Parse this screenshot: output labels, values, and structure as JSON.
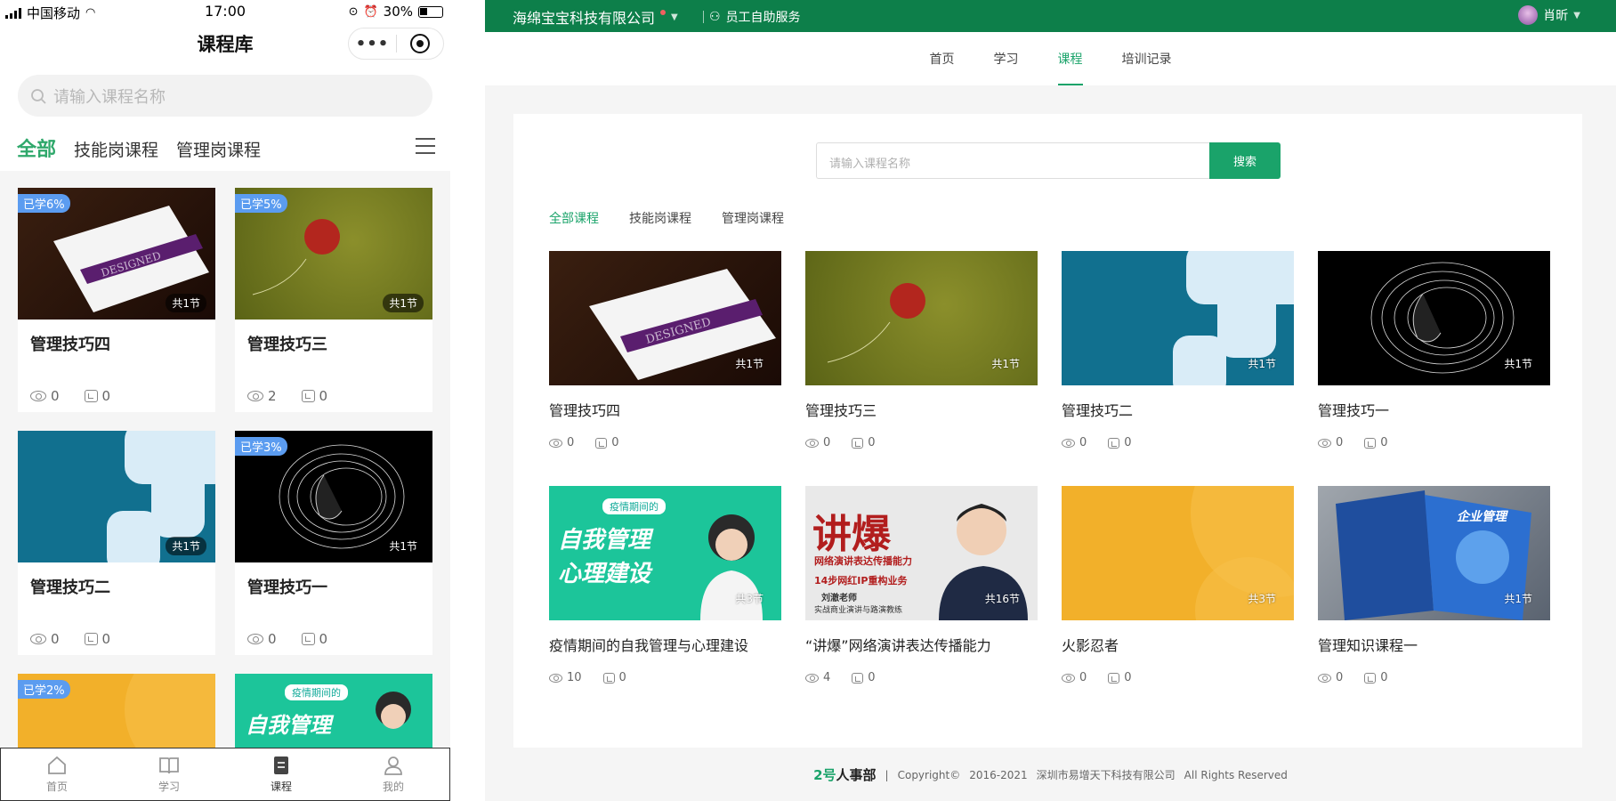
{
  "mobile": {
    "status": {
      "carrier": "中国移动",
      "time": "17:00",
      "battery": "30%"
    },
    "title": "课程库",
    "more_label": "•••",
    "search_placeholder": "请输入课程名称",
    "tabs": [
      "全部",
      "技能岗课程",
      "管理岗课程"
    ],
    "courses": [
      {
        "name": "管理技巧四",
        "progress": "已学6%",
        "lessons": "共1节",
        "views": "0",
        "comments": "0",
        "thumb": "book"
      },
      {
        "name": "管理技巧三",
        "progress": "已学5%",
        "lessons": "共1节",
        "views": "2",
        "comments": "0",
        "thumb": "leaf"
      },
      {
        "name": "管理技巧二",
        "progress": "",
        "lessons": "共1节",
        "views": "0",
        "comments": "0",
        "thumb": "blue"
      },
      {
        "name": "管理技巧一",
        "progress": "已学3%",
        "lessons": "共1节",
        "views": "0",
        "comments": "0",
        "thumb": "spiral"
      },
      {
        "name": "",
        "progress": "已学2%",
        "lessons": "",
        "views": "",
        "comments": "",
        "thumb": "orange"
      },
      {
        "name": "",
        "progress": "",
        "lessons": "",
        "views": "",
        "comments": "",
        "thumb": "green",
        "thumb_text": "疫情期间的",
        "thumb_title": "自我管理"
      }
    ],
    "tabbar": [
      {
        "label": "首页",
        "icon": "home-icon"
      },
      {
        "label": "学习",
        "icon": "book-icon"
      },
      {
        "label": "课程",
        "icon": "course-icon",
        "active": true
      },
      {
        "label": "我的",
        "icon": "user-icon"
      }
    ]
  },
  "web": {
    "company": "海绵宝宝科技有限公司",
    "service": "员工自助服务",
    "user": "肖昕",
    "nav": [
      "首页",
      "学习",
      "课程",
      "培训记录"
    ],
    "nav_active": "课程",
    "search_placeholder": "请输入课程名称",
    "search_button": "搜索",
    "tabs": [
      "全部课程",
      "技能岗课程",
      "管理岗课程"
    ],
    "courses": [
      {
        "name": "管理技巧四",
        "lessons": "共1节",
        "views": "0",
        "comments": "0",
        "thumb": "book"
      },
      {
        "name": "管理技巧三",
        "lessons": "共1节",
        "views": "0",
        "comments": "0",
        "thumb": "leaf"
      },
      {
        "name": "管理技巧二",
        "lessons": "共1节",
        "views": "0",
        "comments": "0",
        "thumb": "blue"
      },
      {
        "name": "管理技巧一",
        "lessons": "共1节",
        "views": "0",
        "comments": "0",
        "thumb": "spiral"
      },
      {
        "name": "疫情期间的自我管理与心理建设",
        "lessons": "共3节",
        "views": "10",
        "comments": "0",
        "thumb": "green",
        "thumb_text": "疫情期间的",
        "thumb_title": "自我管理",
        "thumb_title2": "心理建设"
      },
      {
        "name": "“讲爆”网络演讲表达传播能力",
        "lessons": "共16节",
        "views": "4",
        "comments": "0",
        "thumb": "speak",
        "thumb_title": "讲爆",
        "thumb_text": "网络演讲表达传播能力",
        "thumb_steps": "14步网红IP重构业务",
        "thumb_teacher": "刘澈老师",
        "thumb_teacher_sub": "实战商业演讲与路演教练"
      },
      {
        "name": "火影忍者",
        "lessons": "共3节",
        "views": "0",
        "comments": "0",
        "thumb": "orange"
      },
      {
        "name": "管理知识课程一",
        "lessons": "共1节",
        "views": "0",
        "comments": "0",
        "thumb": "binder",
        "thumb_title": "企业管理"
      }
    ],
    "footer": {
      "brand_num": "2号",
      "brand_text": "人事部",
      "sep": "|",
      "copyright": "Copyright©",
      "years": "2016-2021",
      "company": "深圳市易增天下科技有限公司",
      "rights": "All Rights Reserved"
    }
  }
}
